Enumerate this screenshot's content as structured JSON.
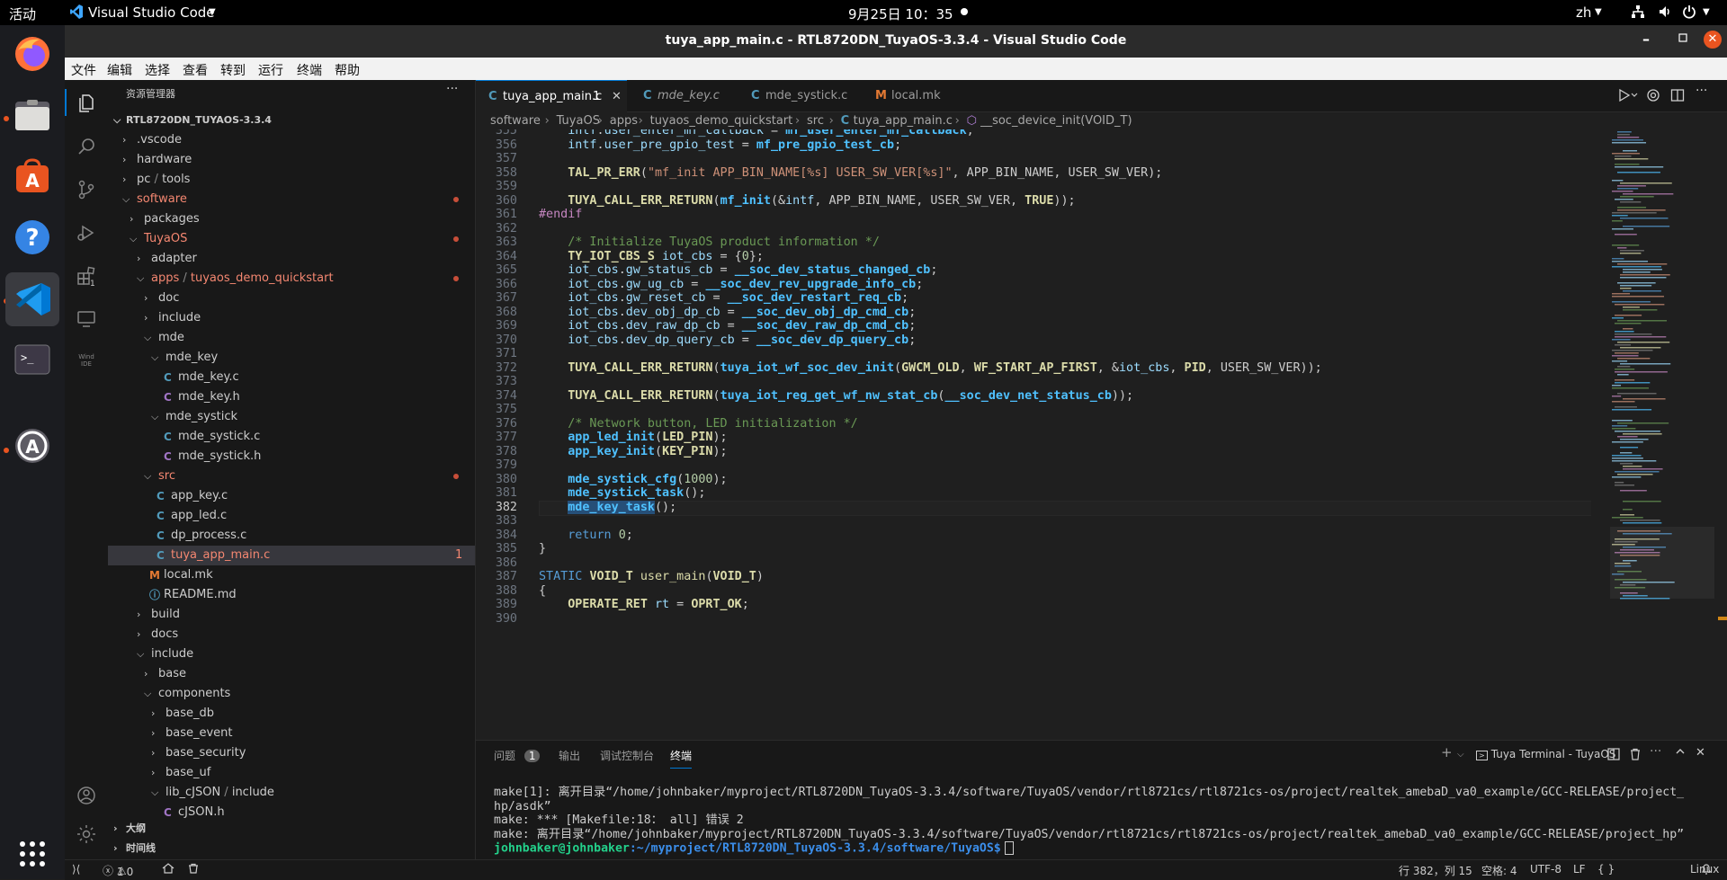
{
  "topbar": {
    "activities": "活动",
    "app": "Visual Studio Code",
    "clock": "9月25日 10：35",
    "lang": "zh"
  },
  "window": {
    "title": "tuya_app_main.c - RTL8720DN_TuyaOS-3.3.4 - Visual Studio Code"
  },
  "menu": [
    "文件",
    "编辑",
    "选择",
    "查看",
    "转到",
    "运行",
    "终端",
    "帮助"
  ],
  "explorer": {
    "header": "资源管理器",
    "root": "RTL8720DN_TUYAOS-3.3.4",
    "rows": [
      {
        "label": ".vscode",
        "type": "folder-closed",
        "indent": 1
      },
      {
        "label": "hardware",
        "type": "folder-closed",
        "indent": 1
      },
      {
        "label": "pc / tools",
        "type": "folder-closed",
        "indent": 1
      },
      {
        "label": "software",
        "type": "folder-open",
        "indent": 1,
        "modified": true
      },
      {
        "label": "packages",
        "type": "folder-closed",
        "indent": 2
      },
      {
        "label": "TuyaOS",
        "type": "folder-open",
        "indent": 2,
        "modified": true
      },
      {
        "label": "adapter",
        "type": "folder-closed",
        "indent": 3
      },
      {
        "label": "apps / tuyaos_demo_quickstart",
        "type": "folder-open",
        "indent": 3,
        "modified": true
      },
      {
        "label": "doc",
        "type": "folder-closed",
        "indent": 4
      },
      {
        "label": "include",
        "type": "folder-closed",
        "indent": 4
      },
      {
        "label": "mde",
        "type": "folder-open",
        "indent": 4
      },
      {
        "label": "mde_key",
        "type": "folder-open",
        "indent": 5
      },
      {
        "label": "mde_key.c",
        "type": "c",
        "indent": 6
      },
      {
        "label": "mde_key.h",
        "type": "h",
        "indent": 6
      },
      {
        "label": "mde_systick",
        "type": "folder-open",
        "indent": 5
      },
      {
        "label": "mde_systick.c",
        "type": "c",
        "indent": 6
      },
      {
        "label": "mde_systick.h",
        "type": "h",
        "indent": 6
      },
      {
        "label": "src",
        "type": "folder-open",
        "indent": 4,
        "modified": true
      },
      {
        "label": "app_key.c",
        "type": "c",
        "indent": 5
      },
      {
        "label": "app_led.c",
        "type": "c",
        "indent": 5
      },
      {
        "label": "dp_process.c",
        "type": "c",
        "indent": 5
      },
      {
        "label": "tuya_app_main.c",
        "type": "c",
        "indent": 5,
        "active": true,
        "badge": "1"
      },
      {
        "label": "local.mk",
        "type": "mk",
        "indent": 4
      },
      {
        "label": "README.md",
        "type": "md",
        "indent": 4
      },
      {
        "label": "build",
        "type": "folder-closed",
        "indent": 3
      },
      {
        "label": "docs",
        "type": "folder-closed",
        "indent": 3
      },
      {
        "label": "include",
        "type": "folder-open",
        "indent": 3
      },
      {
        "label": "base",
        "type": "folder-closed",
        "indent": 4
      },
      {
        "label": "components",
        "type": "folder-open",
        "indent": 4
      },
      {
        "label": "base_db",
        "type": "folder-closed",
        "indent": 5
      },
      {
        "label": "base_event",
        "type": "folder-closed",
        "indent": 5
      },
      {
        "label": "base_security",
        "type": "folder-closed",
        "indent": 5
      },
      {
        "label": "base_uf",
        "type": "folder-closed",
        "indent": 5
      },
      {
        "label": "lib_cJSON / include",
        "type": "folder-open",
        "indent": 5
      },
      {
        "label": "cJSON.h",
        "type": "h",
        "indent": 6
      }
    ],
    "outline": "大纲",
    "timeline": "时间线"
  },
  "tabs": [
    {
      "label": "tuya_app_main.c",
      "icon": "C",
      "suffix": "1",
      "active": true
    },
    {
      "label": "mde_key.c",
      "icon": "C",
      "italic": true
    },
    {
      "label": "mde_systick.c",
      "icon": "C"
    },
    {
      "label": "local.mk",
      "icon": "M"
    }
  ],
  "breadcrumb": [
    "software",
    "TuyaOS",
    "apps",
    "tuyaos_demo_quickstart",
    "src",
    "tuya_app_main.c",
    "__soc_device_init(VOID_T)"
  ],
  "editor": {
    "cursor_line": "382",
    "line_start": 355
  },
  "panel": {
    "tabs": [
      {
        "label": "问题",
        "badge": "1"
      },
      {
        "label": "输出"
      },
      {
        "label": "调试控制台"
      },
      {
        "label": "终端",
        "active": true
      }
    ],
    "terminal_name": "Tuya Terminal - TuyaOS",
    "lines": [
      "make[1]: 离开目录“/home/johnbaker/myproject/RTL8720DN_TuyaOS-3.3.4/software/TuyaOS/vendor/rtl8721cs/rtl8721cs-os/project/realtek_amebaD_va0_example/GCC-RELEASE/project_",
      "hp/asdk”",
      "make: *** [Makefile:18： all] 错误 2",
      "make: 离开目录“/home/johnbaker/myproject/RTL8720DN_TuyaOS-3.3.4/software/TuyaOS/vendor/rtl8721cs/rtl8721cs-os/project/realtek_amebaD_va0_example/GCC-RELEASE/project_hp”"
    ],
    "prompt_user": "johnbaker@johnbaker",
    "prompt_path": ":~/myproject/RTL8720DN_TuyaOS-3.3.4/software/TuyaOS$"
  },
  "status": {
    "errors": "1",
    "warnings": "0",
    "position": "行 382，列 15",
    "spaces": "空格: 4",
    "encoding": "UTF-8",
    "eol": "LF",
    "lang": "Linux"
  }
}
